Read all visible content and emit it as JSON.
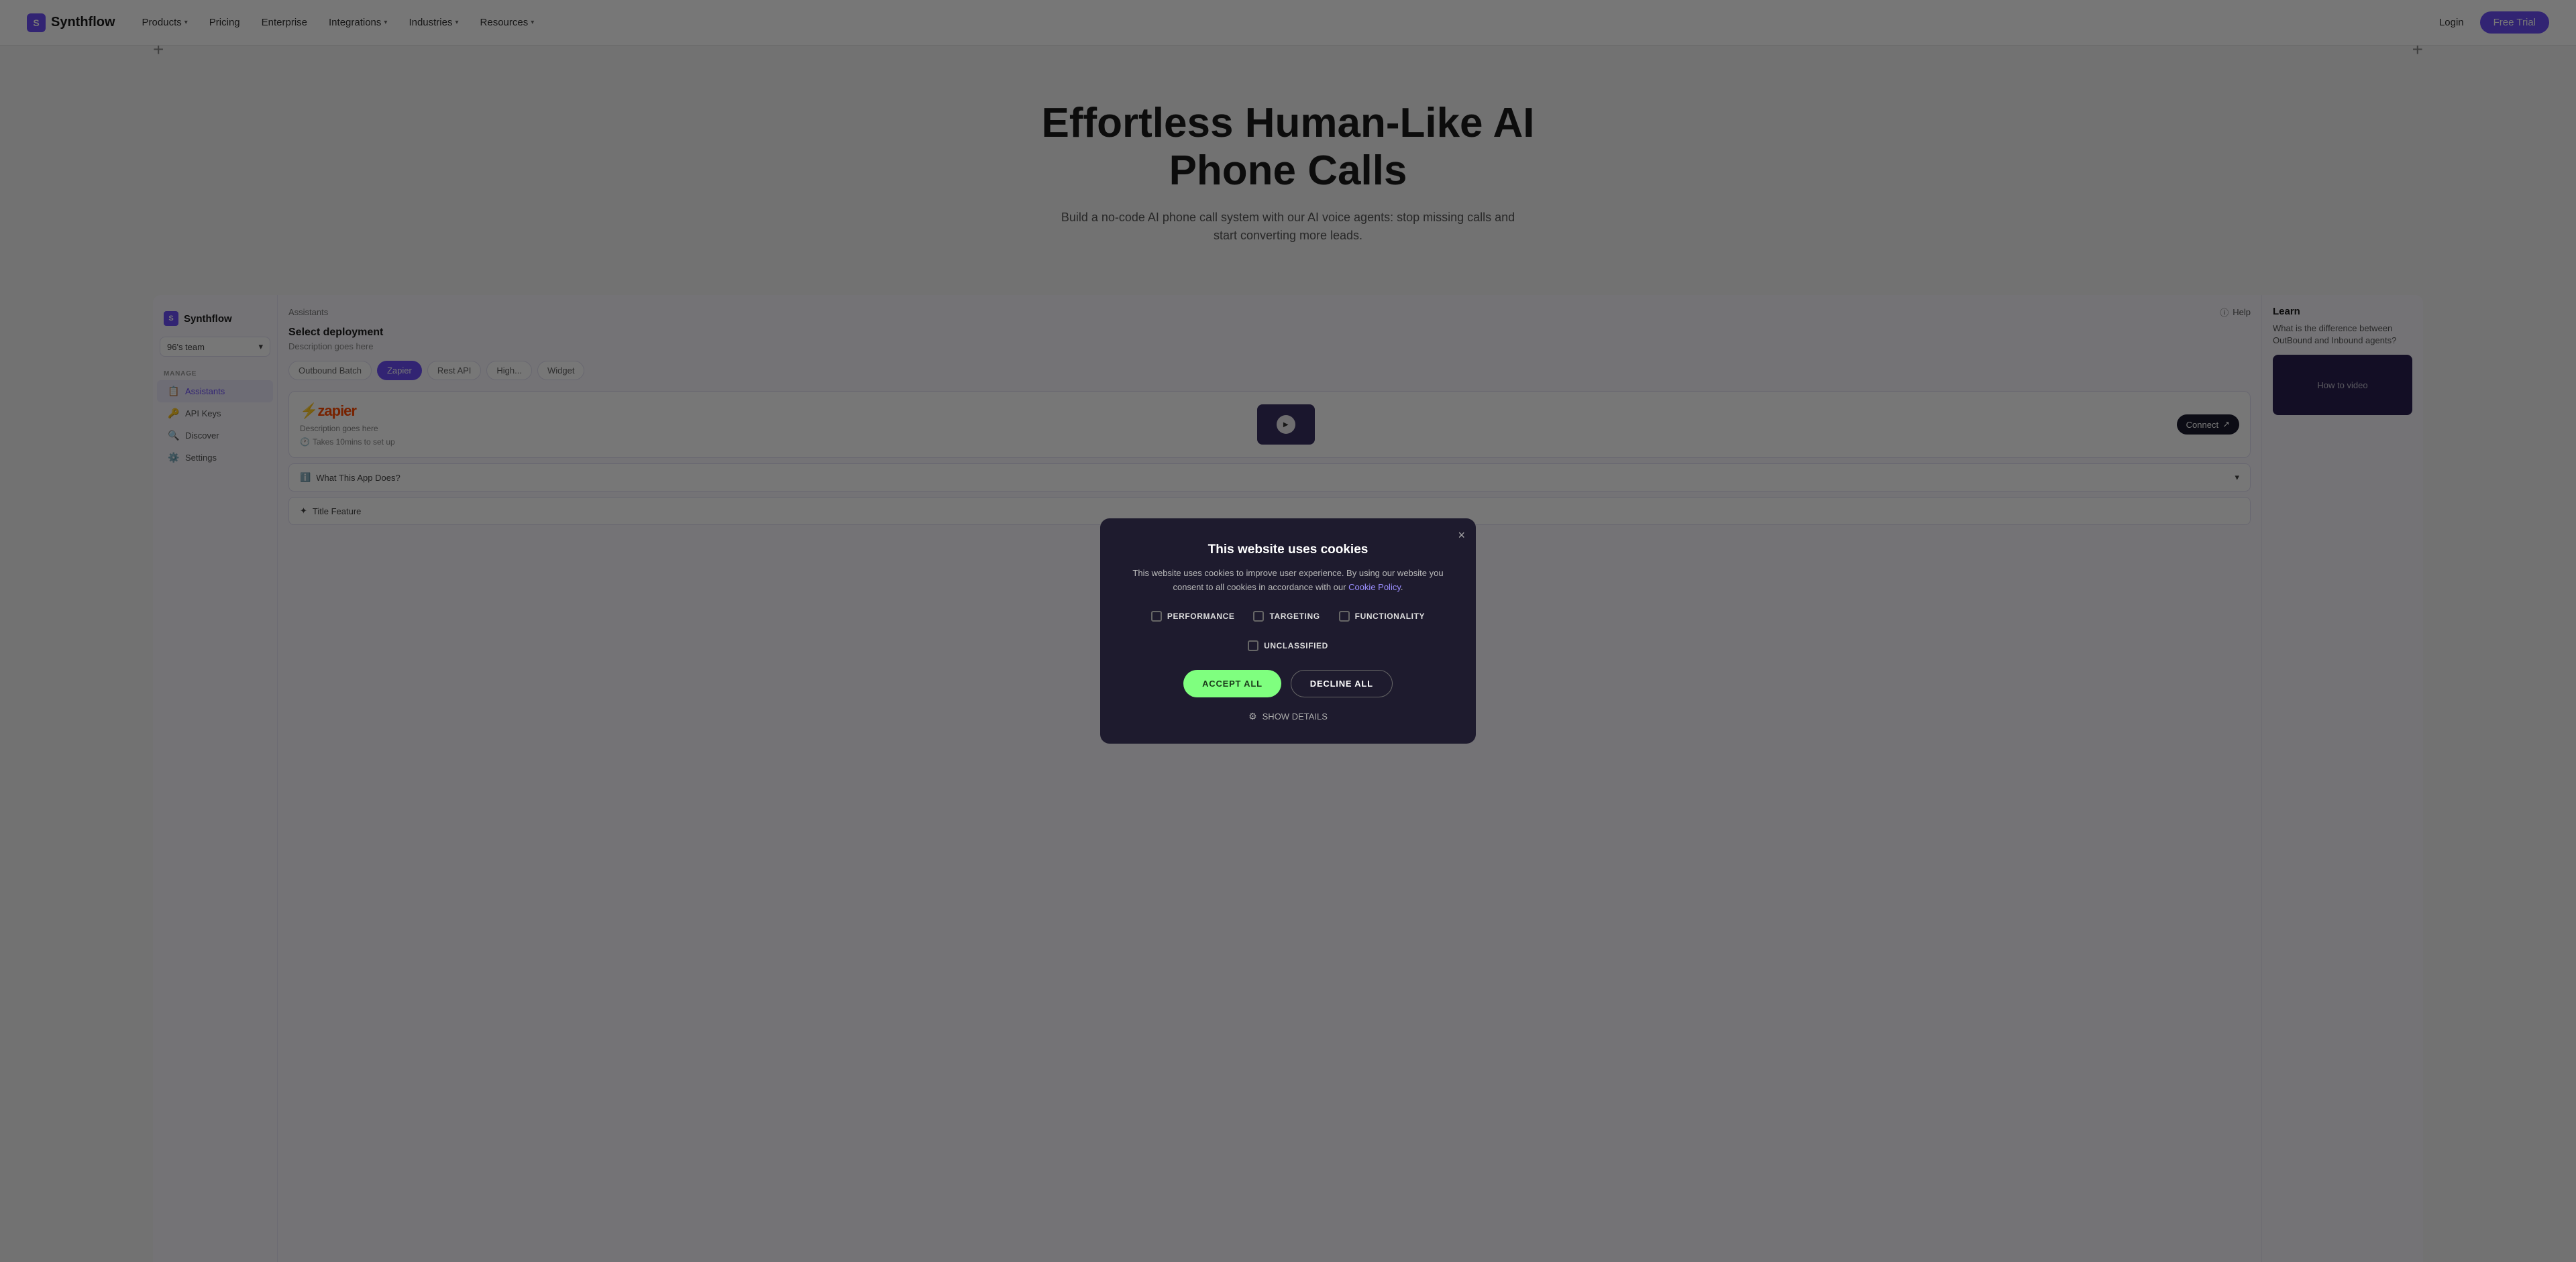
{
  "website": {
    "nav": {
      "logo_text": "Synthflow",
      "items": [
        {
          "label": "Products",
          "has_dropdown": true
        },
        {
          "label": "Pricing",
          "has_dropdown": false
        },
        {
          "label": "Enterprise",
          "has_dropdown": false
        },
        {
          "label": "Integrations",
          "has_dropdown": true
        },
        {
          "label": "Industries",
          "has_dropdown": true
        },
        {
          "label": "Resources",
          "has_dropdown": true
        }
      ],
      "login_label": "Login",
      "free_trial_label": "Free Trial"
    },
    "hero": {
      "title": "Effortless Human-Like AI Phone Calls",
      "subtitle": "Build a no-code AI phone call system with our AI voice agents: stop missing calls and start converting more leads."
    }
  },
  "app": {
    "logo_text": "Synthflow",
    "team_selector": "96's team",
    "manage_label": "MANAGE",
    "sidebar_items": [
      {
        "label": "Assistants",
        "icon": "📋",
        "active": true
      },
      {
        "label": "API Keys",
        "icon": "🔑",
        "active": false
      },
      {
        "label": "Discover",
        "icon": "🔍",
        "active": false
      },
      {
        "label": "Settings",
        "icon": "⚙️",
        "active": false
      }
    ],
    "tabs": [
      {
        "label": "Assistants"
      }
    ],
    "help_label": "Help",
    "deployment": {
      "title": "Select deployment",
      "description": "Description goes here",
      "tabs": [
        {
          "label": "Outbound Batch",
          "active": false
        },
        {
          "label": "Zapier",
          "active": true
        },
        {
          "label": "Rest API",
          "active": false
        },
        {
          "label": "High...",
          "active": false
        },
        {
          "label": "Widget",
          "active": false
        }
      ]
    },
    "zapier_card": {
      "logo": "⚡zapier",
      "description": "Description goes here",
      "time_label": "Takes 10mins to set up",
      "connect_label": "Connect"
    },
    "accordion_items": [
      {
        "label": "What This App Does?"
      },
      {
        "label": "Title Feature"
      }
    ],
    "learn": {
      "title": "Learn",
      "question": "What is the difference between OutBound and Inbound agents?",
      "video_label": "How to video"
    }
  },
  "cookie_modal": {
    "title": "This website uses cookies",
    "description": "This website uses cookies to improve user experience. By using our website you consent to all cookies in accordance with our Cookie Policy.",
    "cookie_policy_label": "Cookie Policy",
    "checkboxes": [
      {
        "label": "PERFORMANCE",
        "checked": false
      },
      {
        "label": "TARGETING",
        "checked": false
      },
      {
        "label": "FUNCTIONALITY",
        "checked": false
      },
      {
        "label": "UNCLASSIFIED",
        "checked": false
      }
    ],
    "accept_all_label": "ACCEPT ALL",
    "decline_all_label": "DECLINE ALL",
    "show_details_label": "SHOW DETAILS",
    "close_icon": "×"
  }
}
